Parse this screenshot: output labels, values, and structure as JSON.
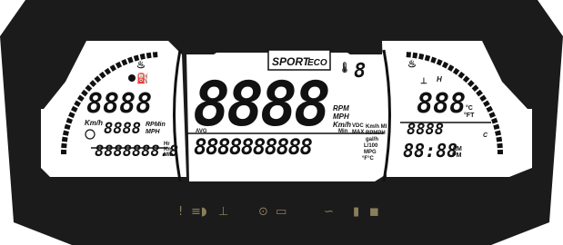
{
  "modes": {
    "sport": "SPORT",
    "eco": "ECO"
  },
  "speed": {
    "digits": "8888",
    "units": [
      "RPM",
      "MPH",
      "Km/h",
      "Min"
    ]
  },
  "left": {
    "top_digits": "8888",
    "mid_label_left": "Km/h",
    "mid_digits": "8888",
    "mid_units": [
      "RPMin",
      "MPH"
    ],
    "odometer": "8888888.8",
    "odo_units": [
      "Hr",
      "Km",
      "Min"
    ]
  },
  "center": {
    "avg": "AVG",
    "digits": "8888888888",
    "units": [
      "VDC",
      "MAX",
      "Km/h MI",
      "RPMPH",
      "gal/h",
      "L/100",
      "MPG",
      "°F°C"
    ]
  },
  "right": {
    "temp_digits": "888",
    "temp_units": [
      "°C",
      "°FT"
    ],
    "h": "H",
    "c": "C",
    "mid_digits": "8888",
    "clock": "88:88",
    "ampm": [
      "AM",
      "PM"
    ]
  },
  "colors": {
    "bezel": "#1b1b1b",
    "lcd": "#ffffff",
    "segment": "#111111",
    "telltale": "#8a7f5a"
  },
  "telltales": [
    "exclamation-icon",
    "headlight-icon",
    "coolant-icon",
    "brake-icon",
    "battery-icon",
    "oil-icon",
    "fuel-icon",
    "engine-icon"
  ]
}
